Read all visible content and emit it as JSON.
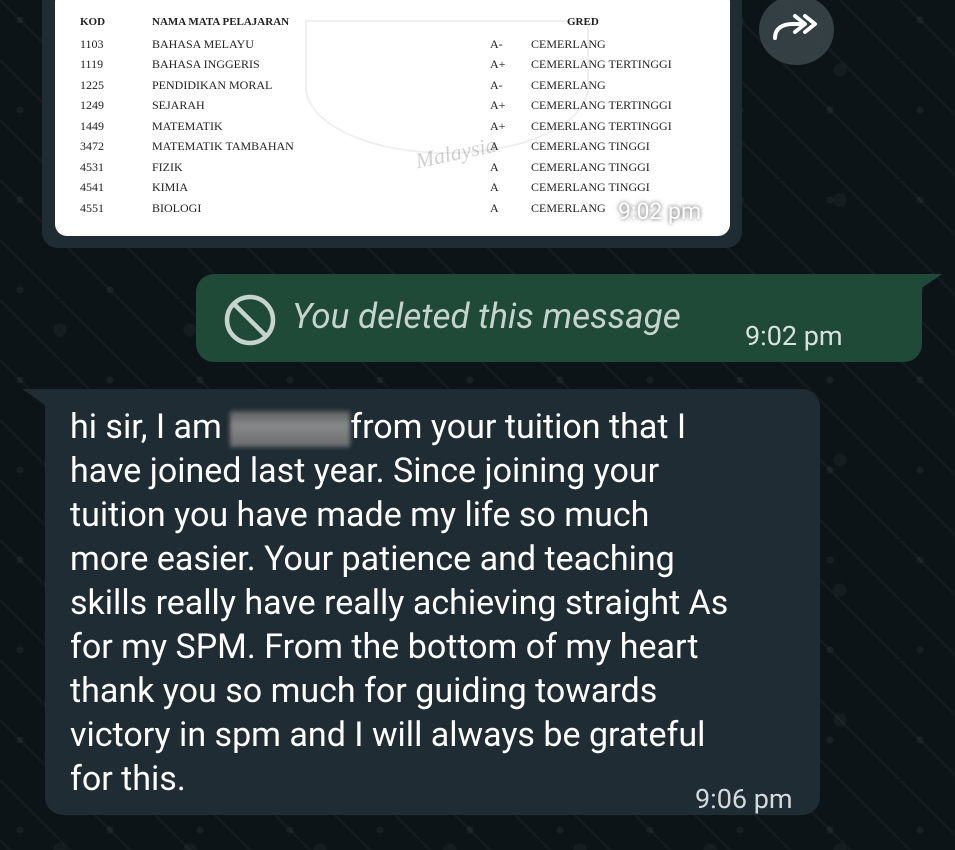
{
  "image_message": {
    "table_headers": {
      "kod": "KOD",
      "nama": "NAMA MATA PELAJARAN",
      "gred": "GRED"
    },
    "rows": [
      {
        "kod": "1103",
        "nama": "BAHASA MELAYU",
        "gred": "A-",
        "desc": "CEMERLANG"
      },
      {
        "kod": "1119",
        "nama": "BAHASA INGGERIS",
        "gred": "A+",
        "desc": "CEMERLANG TERTINGGI"
      },
      {
        "kod": "1225",
        "nama": "PENDIDIKAN MORAL",
        "gred": "A-",
        "desc": "CEMERLANG"
      },
      {
        "kod": "1249",
        "nama": "SEJARAH",
        "gred": "A+",
        "desc": "CEMERLANG TERTINGGI"
      },
      {
        "kod": "1449",
        "nama": "MATEMATIK",
        "gred": "A+",
        "desc": "CEMERLANG TERTINGGI"
      },
      {
        "kod": "3472",
        "nama": "MATEMATIK TAMBAHAN",
        "gred": "A",
        "desc": "CEMERLANG TINGGI"
      },
      {
        "kod": "4531",
        "nama": "FIZIK",
        "gred": "A",
        "desc": "CEMERLANG TINGGI"
      },
      {
        "kod": "4541",
        "nama": "KIMIA",
        "gred": "A",
        "desc": "CEMERLANG TINGGI"
      },
      {
        "kod": "4551",
        "nama": "BIOLOGI",
        "gred": "A",
        "desc": "CEMERLANG"
      }
    ],
    "watermark": "Malaysia",
    "time": "9:02 pm"
  },
  "deleted_message": {
    "text": "You deleted this message",
    "time": "9:02 pm"
  },
  "text_message": {
    "line1_before": "hi sir, I am ",
    "line1_after": "from your tuition that I",
    "lines": [
      "have joined last year. Since joining your",
      "tuition you have made my life so much",
      "more easier. Your patience and teaching",
      "skills really have really achieving straight As",
      "for my SPM. From the bottom of my heart",
      "thank you so much for guiding towards",
      "victory in spm and I will always be grateful",
      "for this."
    ],
    "time": "9:06 pm"
  },
  "icons": {
    "forward": "forward-icon",
    "deleted": "prohibited-icon"
  }
}
